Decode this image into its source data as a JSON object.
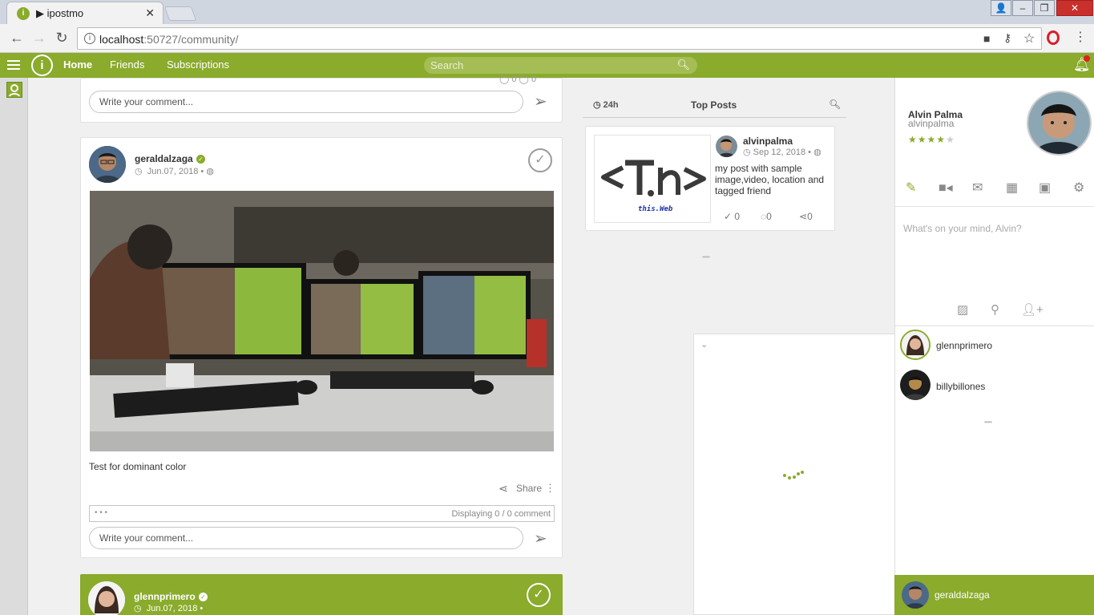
{
  "browser": {
    "tab_title": "ipostmo",
    "tab_play": "▶",
    "url_host": "localhost",
    "url_rest": ":50727/community/"
  },
  "nav": {
    "home": "Home",
    "friends": "Friends",
    "subscriptions": "Subscriptions",
    "search_placeholder": "Search"
  },
  "feed": {
    "top_comment_placeholder": "Write your comment...",
    "top_counts": "0",
    "post": {
      "author": "geraldalzaga",
      "date": "Jun.07, 2018",
      "caption": "Test for dominant color",
      "share": "Share",
      "comments_dots": "• • •",
      "comments_status": "Displaying 0 / 0 comment",
      "comment_placeholder": "Write your comment..."
    },
    "next_post": {
      "author": "glennprimero",
      "date": "Jun.07, 2018"
    }
  },
  "top_posts": {
    "period": "24h",
    "title": "Top Posts",
    "item": {
      "author": "alvinpalma",
      "date": "Sep 12, 2018",
      "text": "my post with sample image,video, location and tagged friend",
      "likes": "0",
      "comments": "0",
      "shares": "0",
      "thumb_text": "this.Web"
    },
    "more_dots": "•••••"
  },
  "profile": {
    "name": "Alvin Palma",
    "username": "alvinpalma",
    "rating": 4,
    "rating_max": 5,
    "composer_placeholder": "What's on your mind, Alvin?",
    "friends": [
      {
        "name": "glennprimero"
      },
      {
        "name": "billybillones"
      }
    ],
    "more_dots": "•••••",
    "chat_user": "geraldalzaga"
  },
  "colors": {
    "brand": "#8aab2c"
  }
}
